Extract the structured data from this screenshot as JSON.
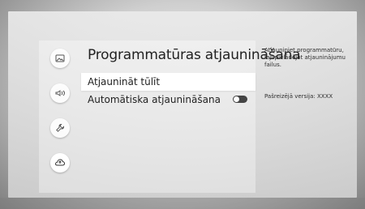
{
  "header": {
    "title": "Programmatūras atjaunināšana"
  },
  "menu": {
    "items": [
      {
        "label": "Atjaunināt tūlīt",
        "focused": true
      },
      {
        "label": "Automātiska atjaunināšana",
        "toggle": "off"
      }
    ]
  },
  "help_panel": {
    "description": "Atjauniniet programmatūru, lejupielādējot atjauninājumu failus.",
    "current_version": "Pašreizējā versija: XXXX"
  },
  "left_rail": {
    "icons": [
      "picture-icon",
      "sound-icon",
      "support-wrench-icon",
      "software-update-cloud-icon"
    ]
  },
  "colors": {
    "focus_background": "#ffffff",
    "text_primary": "#222222",
    "toggle_off": "#444444"
  }
}
